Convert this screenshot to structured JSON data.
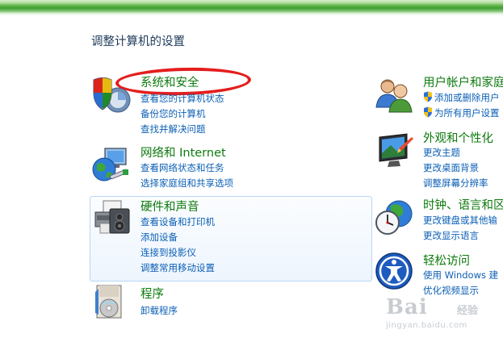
{
  "window": {
    "title": "调整计算机的设置"
  },
  "categories": [
    {
      "title": "系统和安全",
      "links": [
        "查看您的计算机状态",
        "备份您的计算机",
        "查找并解决问题"
      ],
      "icon": "shield-computer-icon"
    },
    {
      "title": "网络和 Internet",
      "links": [
        "查看网络状态和任务",
        "选择家庭组和共享选项"
      ],
      "icon": "network-globe-icon"
    },
    {
      "title": "硬件和声音",
      "links": [
        "查看设备和打印机",
        "添加设备",
        "连接到投影仪",
        "调整常用移动设置"
      ],
      "icon": "printer-icon"
    },
    {
      "title": "程序",
      "links": [
        "卸载程序"
      ],
      "icon": "programs-icon"
    },
    {
      "title": "用户帐户和家庭",
      "links": [
        "添加或删除用户",
        "为所有用户设置"
      ],
      "icon": "users-icon"
    },
    {
      "title": "外观和个性化",
      "links": [
        "更改主题",
        "更改桌面背景",
        "调整屏幕分辨率"
      ],
      "icon": "display-icon"
    },
    {
      "title": "时钟、语言和区",
      "links": [
        "更改键盘或其他输",
        "更改显示语言"
      ],
      "icon": "clock-globe-icon"
    },
    {
      "title": "轻松访问",
      "links": [
        "使用 Windows 建",
        "优化视频显示"
      ],
      "icon": "ease-of-access-icon"
    }
  ],
  "watermark": {
    "main": "Bai",
    "side": "经验",
    "sub": "jingyan.baidu.com"
  },
  "colors": {
    "category_title": "#0d7a0d",
    "link": "#0b5fb5",
    "annotation": "#e41e1e",
    "hover_border": "#b8d6f5"
  }
}
